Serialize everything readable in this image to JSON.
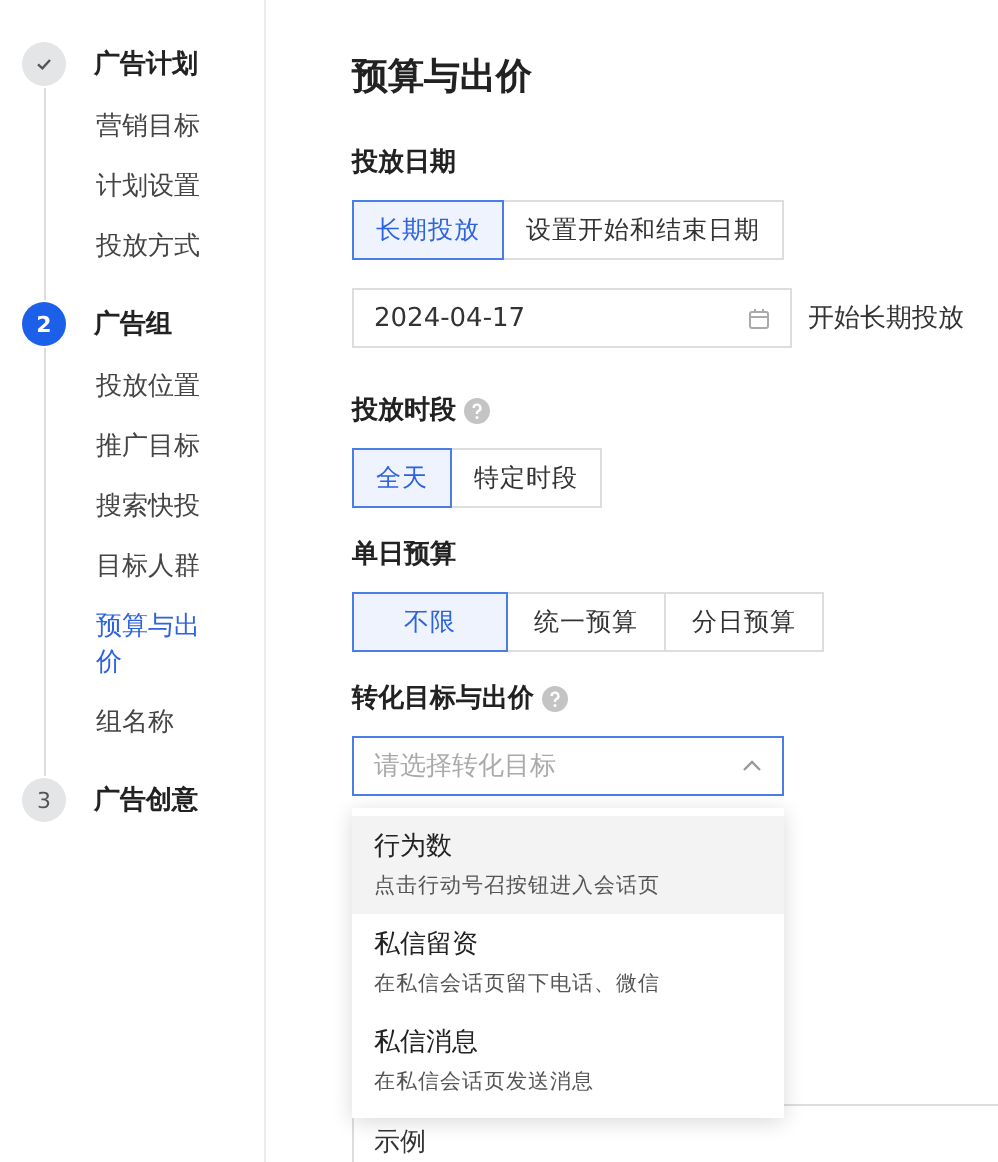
{
  "steps": [
    {
      "kind": "done",
      "title": "广告计划",
      "items": [
        {
          "label": "营销目标",
          "selected": false
        },
        {
          "label": "计划设置",
          "selected": false
        },
        {
          "label": "投放方式",
          "selected": false
        }
      ]
    },
    {
      "number": "2",
      "kind": "active",
      "title": "广告组",
      "items": [
        {
          "label": "投放位置",
          "selected": false
        },
        {
          "label": "推广目标",
          "selected": false
        },
        {
          "label": "搜索快投",
          "selected": false
        },
        {
          "label": "目标人群",
          "selected": false
        },
        {
          "label": "预算与出价",
          "selected": true
        },
        {
          "label": "组名称",
          "selected": false
        }
      ]
    },
    {
      "number": "3",
      "kind": "pending",
      "title": "广告创意"
    }
  ],
  "page_title": "预算与出价",
  "date_section": {
    "label": "投放日期",
    "options": [
      {
        "label": "长期投放",
        "selected": true
      },
      {
        "label": "设置开始和结束日期",
        "selected": false
      }
    ],
    "date_value": "2024-04-17",
    "date_note": "开始长期投放"
  },
  "time_section": {
    "label": "投放时段",
    "options": [
      {
        "label": "全天",
        "selected": true
      },
      {
        "label": "特定时段",
        "selected": false
      }
    ]
  },
  "budget_section": {
    "label": "单日预算",
    "options": [
      {
        "label": "不限",
        "selected": true
      },
      {
        "label": "统一预算",
        "selected": false
      },
      {
        "label": "分日预算",
        "selected": false
      }
    ]
  },
  "conversion_section": {
    "label": "转化目标与出价",
    "placeholder": "请选择转化目标",
    "expanded": true,
    "options": [
      {
        "title": "行为数",
        "description": "点击行动号召按钮进入会话页",
        "selected": true
      },
      {
        "title": "私信留资",
        "description": "在私信会话页留下电话、微信",
        "selected": false
      },
      {
        "title": "私信消息",
        "description": "在私信会话页发送消息",
        "selected": false
      }
    ]
  },
  "example_field": {
    "value": "示例"
  }
}
